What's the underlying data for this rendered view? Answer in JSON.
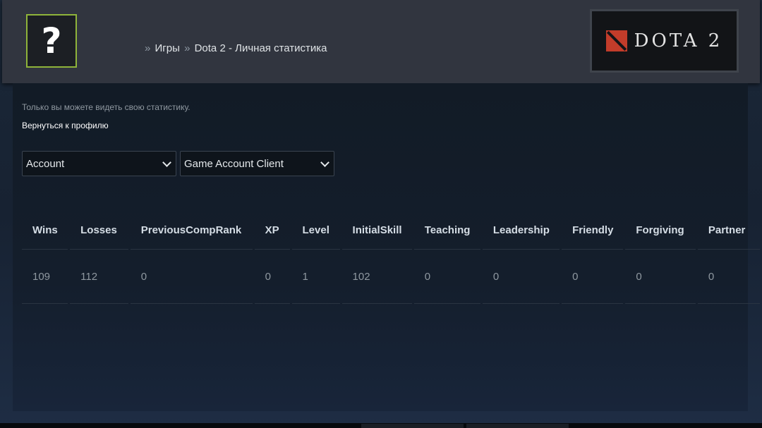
{
  "header": {
    "avatar_placeholder": "?",
    "breadcrumb": {
      "separator": "»",
      "items": [
        "Игры",
        "Dota 2 - Личная статистика"
      ]
    },
    "game_logo_text": "DOTA 2"
  },
  "privacy_note": "Только вы можете видеть свою статистику.",
  "back_link": "Вернуться к профилю",
  "filters": {
    "account": {
      "selected": "Account"
    },
    "client": {
      "selected": "Game Account Client"
    }
  },
  "stats": {
    "columns": [
      "Wins",
      "Losses",
      "PreviousCompRank",
      "XP",
      "Level",
      "InitialSkill",
      "Teaching",
      "Leadership",
      "Friendly",
      "Forgiving",
      "Partner"
    ],
    "values": [
      "109",
      "112",
      "0",
      "0",
      "1",
      "102",
      "0",
      "0",
      "0",
      "0",
      "0"
    ]
  },
  "colors": {
    "avatar_border": "#8fb43a",
    "header_bg": "#31353f",
    "logo_red": "#c23c2a"
  }
}
